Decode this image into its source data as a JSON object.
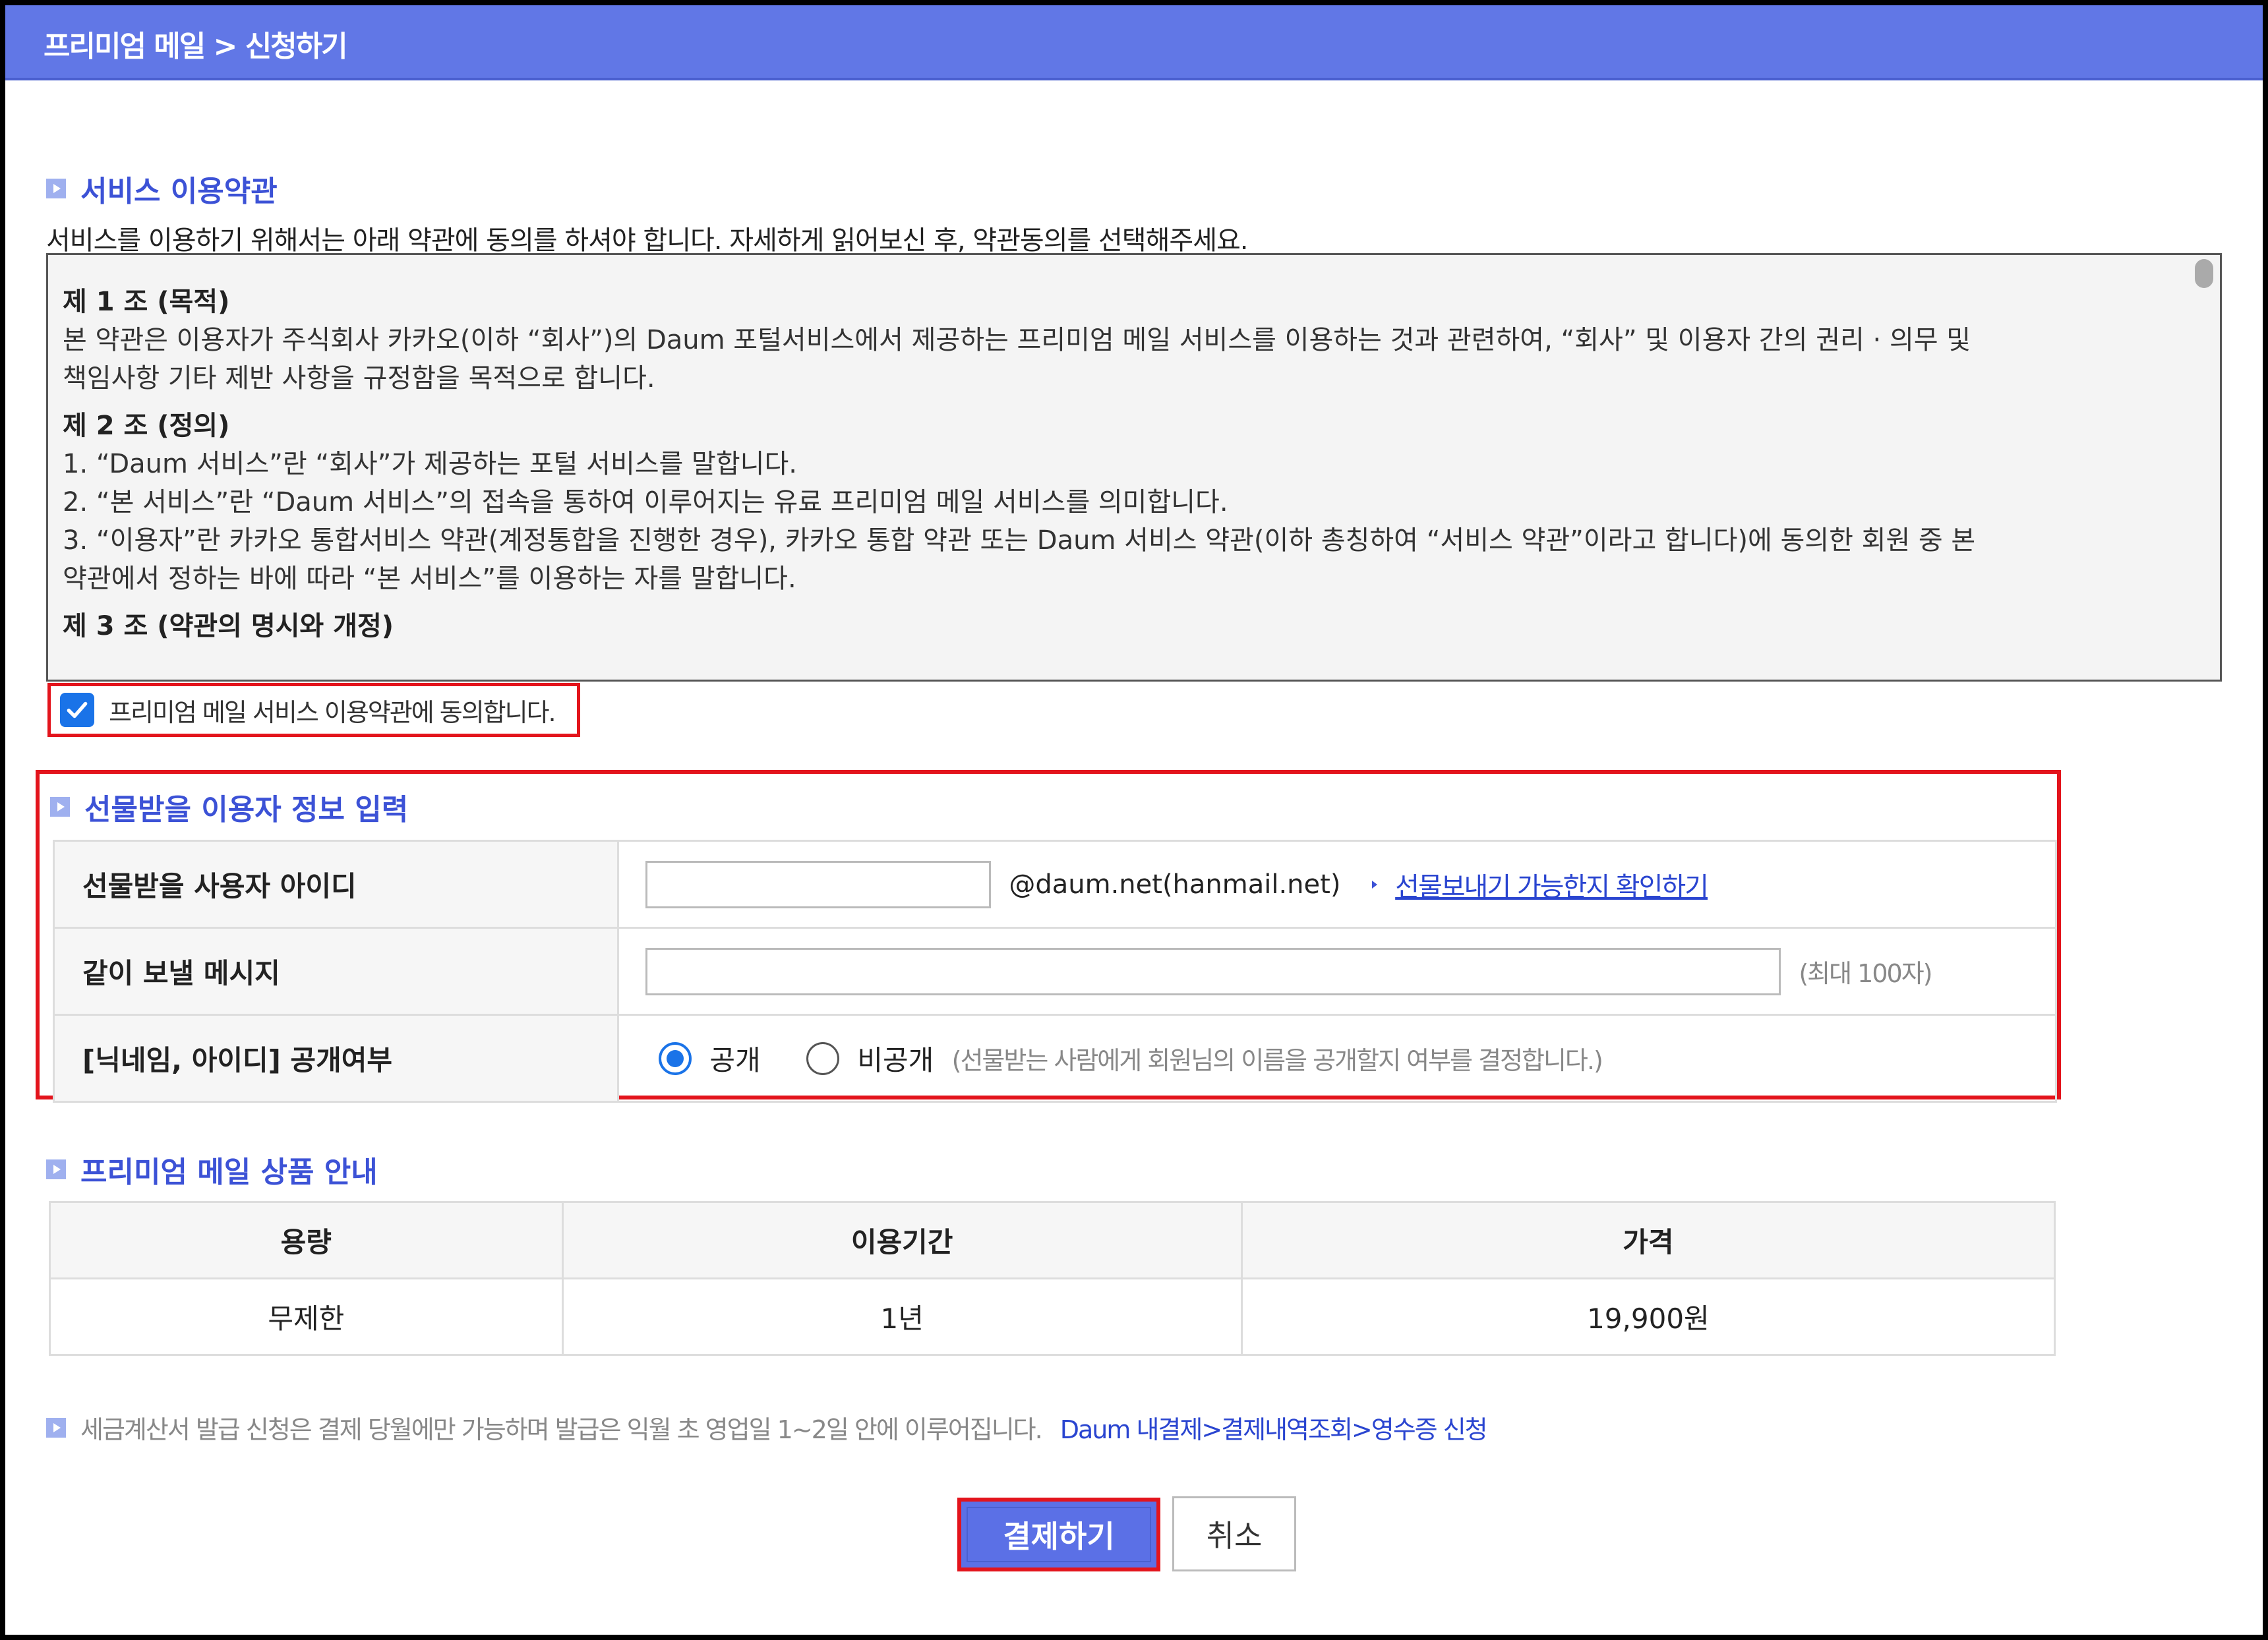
{
  "header": {
    "breadcrumb": "프리미엄 메일 > 신청하기"
  },
  "terms": {
    "section_title": "서비스 이용약관",
    "intro": "서비스를 이용하기 위해서는 아래 약관에 동의를 하셔야 합니다. 자세하게 읽어보신 후, 약관동의를 선택해주세요.",
    "articles": [
      {
        "title": "제 1 조 (목적)",
        "lines": [
          "본 약관은 이용자가 주식회사 카카오(이하 “회사”)의 Daum 포털서비스에서 제공하는 프리미엄 메일 서비스를 이용하는 것과 관련하여, “회사” 및 이용자 간의 권리 · 의무 및",
          "책임사항 기타 제반 사항을 규정함을 목적으로 합니다."
        ]
      },
      {
        "title": "제 2 조 (정의)",
        "lines": [
          "1. “Daum 서비스”란 “회사”가 제공하는 포털 서비스를 말합니다.",
          "2. “본 서비스”란 “Daum 서비스”의 접속을 통하여 이루어지는 유료 프리미엄 메일 서비스를 의미합니다.",
          "3. “이용자”란 카카오 통합서비스 약관(계정통합을 진행한 경우), 카카오 통합 약관 또는 Daum 서비스 약관(이하 총칭하여 “서비스 약관”이라고 합니다)에 동의한 회원 중 본",
          "약관에서 정하는 바에 따라 “본 서비스”를 이용하는 자를 말합니다."
        ]
      },
      {
        "title": "제 3 조 (약관의 명시와 개정)",
        "lines": []
      }
    ],
    "agree_label": "프리미엄 메일 서비스 이용약관에 동의합니다.",
    "agree_checked": true
  },
  "gift": {
    "section_title": "선물받을 이용자 정보 입력",
    "rows": {
      "user_id_label": "선물받을 사용자 아이디",
      "user_id_value": "",
      "domain": "@daum.net(hanmail.net)",
      "check_link": "선물보내기 가능한지 확인하기",
      "message_label": "같이 보낼 메시지",
      "message_value": "",
      "message_hint": "(최대 100자)",
      "visibility_label": "[닉네임, 아이디] 공개여부",
      "public_label": "공개",
      "private_label": "비공개",
      "visibility_hint": "(선물받는 사람에게 회원님의 이름을 공개할지 여부를 결정합니다.)",
      "selected": "공개"
    }
  },
  "product": {
    "section_title": "프리미엄 메일 상품 안내",
    "headers": [
      "용량",
      "이용기간",
      "가격"
    ],
    "rows": [
      [
        "무제한",
        "1년",
        "19,900원"
      ]
    ]
  },
  "tax_note": {
    "text": "세금계산서 발급 신청은 결제 당월에만 가능하며 발급은 익월 초 영업일 1~2일 안에 이루어집니다.",
    "link": "Daum 내결제>결제내역조회>영수증 신청"
  },
  "buttons": {
    "pay": "결제하기",
    "cancel": "취소"
  },
  "colors": {
    "header": "#6177e6",
    "accent": "#3c52d6",
    "highlight": "#e3141c"
  }
}
